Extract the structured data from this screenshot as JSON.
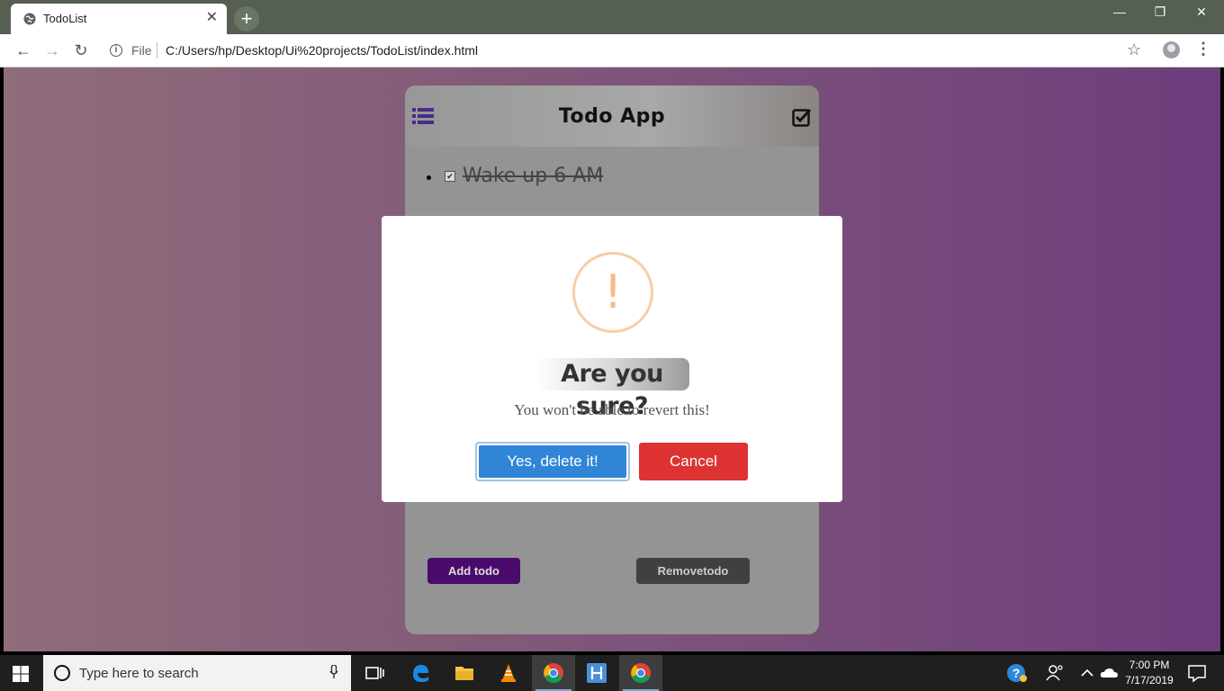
{
  "browser": {
    "tab_title": "TodoList",
    "tab_close": "✕",
    "new_tab": "+",
    "window_controls": {
      "minimize": "—",
      "maximize": "❐",
      "close": "✕"
    },
    "nav": {
      "back": "←",
      "forward": "→",
      "reload": "↻"
    },
    "info_icon": "i",
    "scheme_label": "File",
    "url": "C:/Users/hp/Desktop/Ui%20projects/TodoList/index.html",
    "bookmark_icon": "☆",
    "menu_icon": "⋮"
  },
  "app": {
    "title": "Todo App",
    "todos": [
      {
        "text": "Wake up 6 AM",
        "done": true,
        "check": "✔"
      }
    ],
    "add_button": "Add todo",
    "remove_button": "Removetodo",
    "colors": {
      "accent": "#4a0b6c",
      "panel": "#949494"
    }
  },
  "modal": {
    "icon": "!",
    "title": "Are you sure?",
    "text": "You won't be able to revert this!",
    "confirm_label": "Yes, delete it!",
    "cancel_label": "Cancel",
    "colors": {
      "confirm": "#3085d6",
      "cancel": "#dd3333",
      "warning": "#f8bb86"
    }
  },
  "taskbar": {
    "search_placeholder": "Type here to search",
    "apps": [
      "task-view-icon",
      "edge-icon",
      "file-explorer-icon",
      "vlc-icon",
      "chrome-icon",
      "app-icon",
      "chrome-icon"
    ],
    "clock_time": "7:00 PM",
    "clock_date": "7/17/2019"
  }
}
